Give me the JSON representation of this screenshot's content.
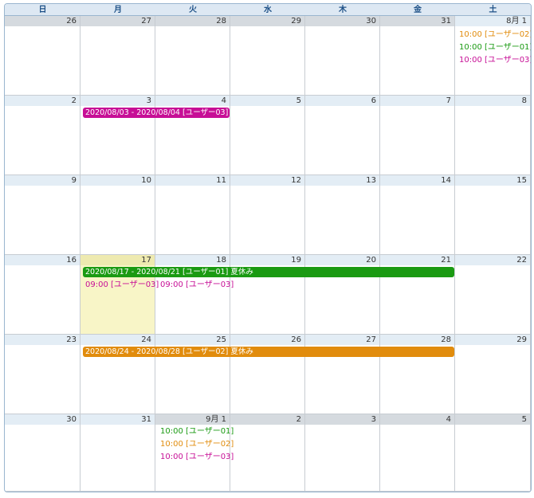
{
  "weekdays": [
    "日",
    "月",
    "火",
    "水",
    "木",
    "金",
    "土"
  ],
  "weeks": [
    [
      "26",
      "27",
      "28",
      "29",
      "30",
      "31",
      "8月 1"
    ],
    [
      "2",
      "3",
      "4",
      "5",
      "6",
      "7",
      "8"
    ],
    [
      "9",
      "10",
      "11",
      "12",
      "13",
      "14",
      "15"
    ],
    [
      "16",
      "17",
      "18",
      "19",
      "20",
      "21",
      "22"
    ],
    [
      "23",
      "24",
      "25",
      "26",
      "27",
      "28",
      "29"
    ],
    [
      "30",
      "31",
      "9月 1",
      "2",
      "3",
      "4",
      "5"
    ]
  ],
  "colors": {
    "user01": "#1a9a12",
    "user02": "#e18c0d",
    "user03": "#c70f96"
  },
  "events": {
    "aug01": [
      "10:00 [ユーザー02]",
      "10:00 [ユーザー01]",
      "10:00 [ユーザー03]"
    ],
    "aug17": [
      "09:00 [ユーザー03]"
    ],
    "aug18": [
      "09:00 [ユーザー03]"
    ],
    "sep01": [
      "10:00 [ユーザー01]",
      "10:00 [ユーザー02]",
      "10:00 [ユーザー03]"
    ]
  },
  "bars": {
    "aug03": "2020/08/03 - 2020/08/04 [ユーザー03]",
    "aug17": "2020/08/17 - 2020/08/21 [ユーザー01] 夏休み",
    "aug24": "2020/08/24 - 2020/08/28 [ユーザー02] 夏休み"
  }
}
